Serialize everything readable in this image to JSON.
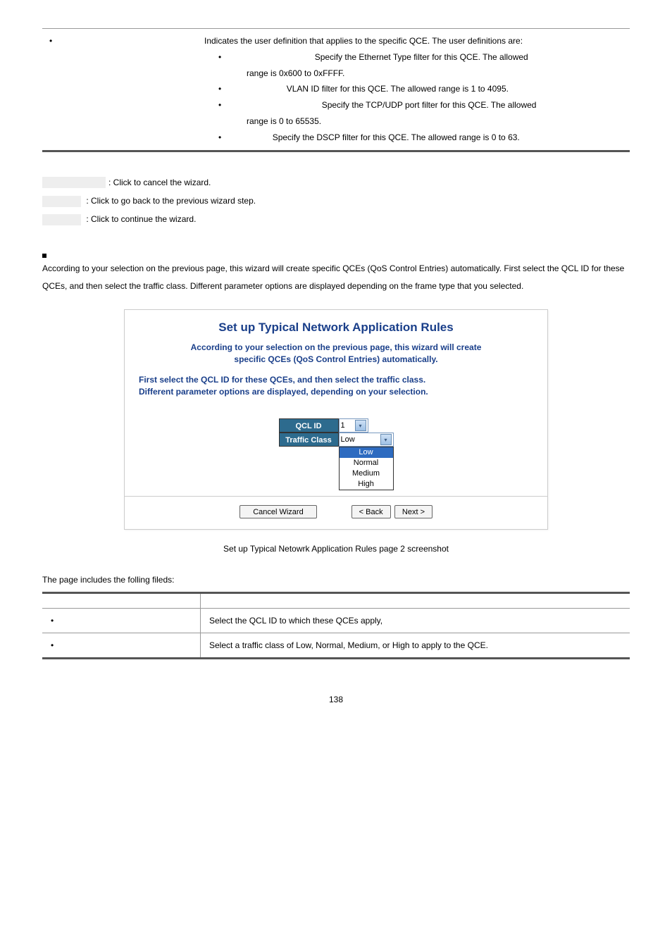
{
  "top_table": {
    "intro": "Indicates the user definition that applies to the specific QCE. The user definitions are:",
    "items": [
      {
        "text": "Specify the Ethernet Type filter for this QCE. The allowed",
        "cont": "range is 0x600 to 0xFFFF."
      },
      {
        "text": "VLAN ID filter for this QCE. The allowed range is 1 to 4095.",
        "cont": ""
      },
      {
        "text": "Specify the TCP/UDP port filter for this QCE. The allowed",
        "cont": "range is 0 to 65535."
      },
      {
        "text": "Specify the DSCP filter for this QCE. The allowed range is 0 to 63.",
        "cont": ""
      }
    ]
  },
  "buttons_help": {
    "cancel": ": Click to cancel the wizard.",
    "back": " : Click to go back to the previous wizard step.",
    "next": " : Click to continue the wizard."
  },
  "paragraph": "According to your selection on the previous page, this wizard will create specific QCEs (QoS Control Entries) automatically. First select the QCL ID for these QCEs, and then select the traffic class. Different parameter options are displayed depending on the frame type that you selected.",
  "screenshot": {
    "title": "Set up Typical Network Application Rules",
    "sub1a": "According to your selection on the previous page, this wizard will create",
    "sub1b": "specific QCEs (QoS Control Entries) automatically.",
    "sub2a": "First select the QCL ID for these QCEs, and then select the traffic class.",
    "sub2b": "Different parameter options are displayed, depending on your selection.",
    "label_qcl": "QCL ID",
    "label_tc": "Traffic Class",
    "qcl_val": "1",
    "tc_val": "Low",
    "options": [
      "Low",
      "Normal",
      "Medium",
      "High"
    ],
    "btn_cancel": "Cancel Wizard",
    "btn_back": "< Back",
    "btn_next": "Next >"
  },
  "caption": "Set up Typical Netowrk Application Rules page 2 screenshot",
  "table2_intro": "The page includes the folling fileds:",
  "table2": {
    "row1_desc": "Select the QCL ID to which these QCEs apply,",
    "row2_desc": "Select a traffic class of Low, Normal, Medium, or High to apply to the QCE."
  },
  "page_num": "138"
}
